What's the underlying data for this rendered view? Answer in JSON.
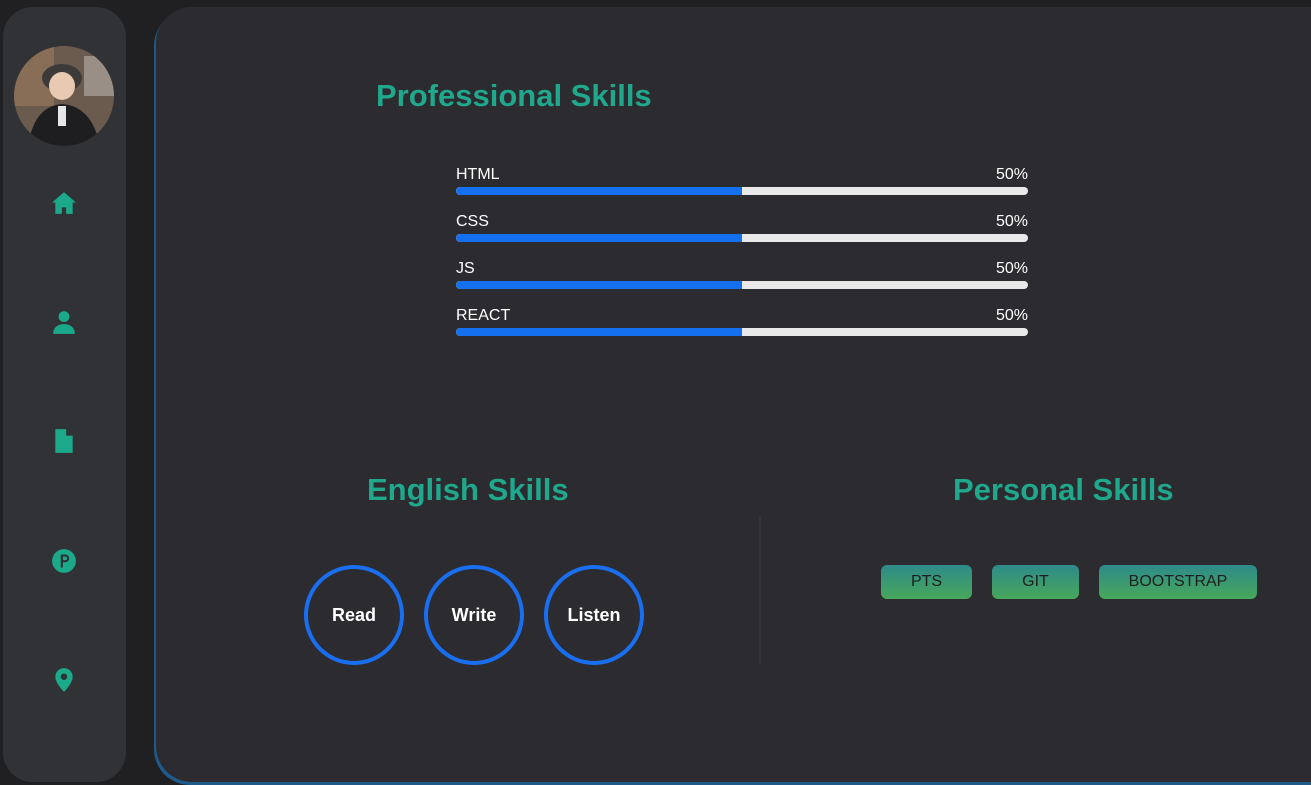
{
  "sidebar": {
    "nav": [
      {
        "icon": "home-icon"
      },
      {
        "icon": "user-icon"
      },
      {
        "icon": "file-icon"
      },
      {
        "icon": "parking-icon"
      },
      {
        "icon": "location-pin-icon"
      }
    ]
  },
  "professional": {
    "title": "Professional Skills",
    "skills": [
      {
        "name": "HTML",
        "percent_label": "50%",
        "percent": 50
      },
      {
        "name": "CSS",
        "percent_label": "50%",
        "percent": 50
      },
      {
        "name": "JS",
        "percent_label": "50%",
        "percent": 50
      },
      {
        "name": "REACT",
        "percent_label": "50%",
        "percent": 50
      }
    ]
  },
  "english": {
    "title": "English Skills",
    "items": [
      "Read",
      "Write",
      "Listen"
    ]
  },
  "personal": {
    "title": "Personal Skills",
    "tags": [
      "PTS",
      "GIT",
      "BOOTSTRAP"
    ]
  },
  "colors": {
    "accent": "#1fa88c",
    "bar_fill": "#1570f0",
    "bar_track": "#e9e9ea",
    "circle_border": "#1a6ff0"
  }
}
